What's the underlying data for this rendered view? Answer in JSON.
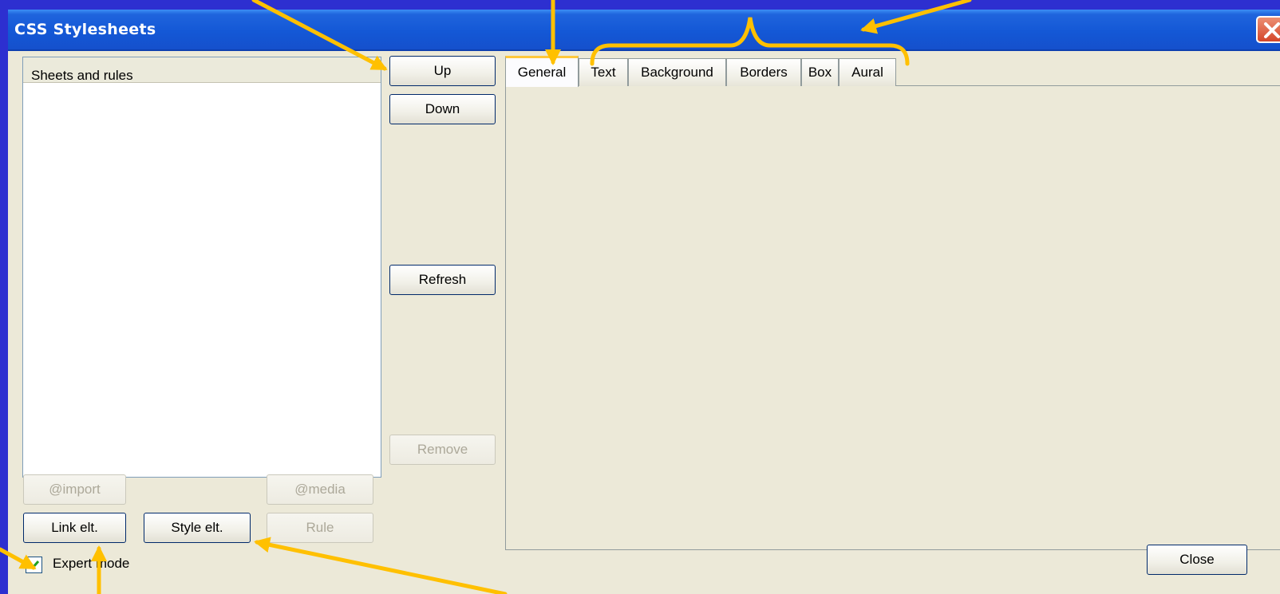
{
  "window": {
    "title": "CSS Stylesheets"
  },
  "list": {
    "header": "Sheets and rules",
    "items": []
  },
  "buttons": {
    "up": "Up",
    "down": "Down",
    "refresh": "Refresh",
    "remove": "Remove",
    "import": "@import",
    "media": "@media",
    "link": "Link elt.",
    "style": "Style elt.",
    "rule": "Rule",
    "close": "Close"
  },
  "tabs": [
    {
      "label": "General",
      "active": true
    },
    {
      "label": "Text",
      "active": false
    },
    {
      "label": "Background",
      "active": false
    },
    {
      "label": "Borders",
      "active": false
    },
    {
      "label": "Box",
      "active": false
    },
    {
      "label": "Aural",
      "active": false
    }
  ],
  "expert_mode": {
    "label": "Expert mode",
    "checked": true
  },
  "colors": {
    "slide_background": "#2d2fd0",
    "annotation": "#ffc000",
    "titlebar": "#1458d6",
    "dialog": "#ece9d8"
  },
  "icons": {
    "close": "close-x-icon",
    "check": "checkmark-icon"
  }
}
